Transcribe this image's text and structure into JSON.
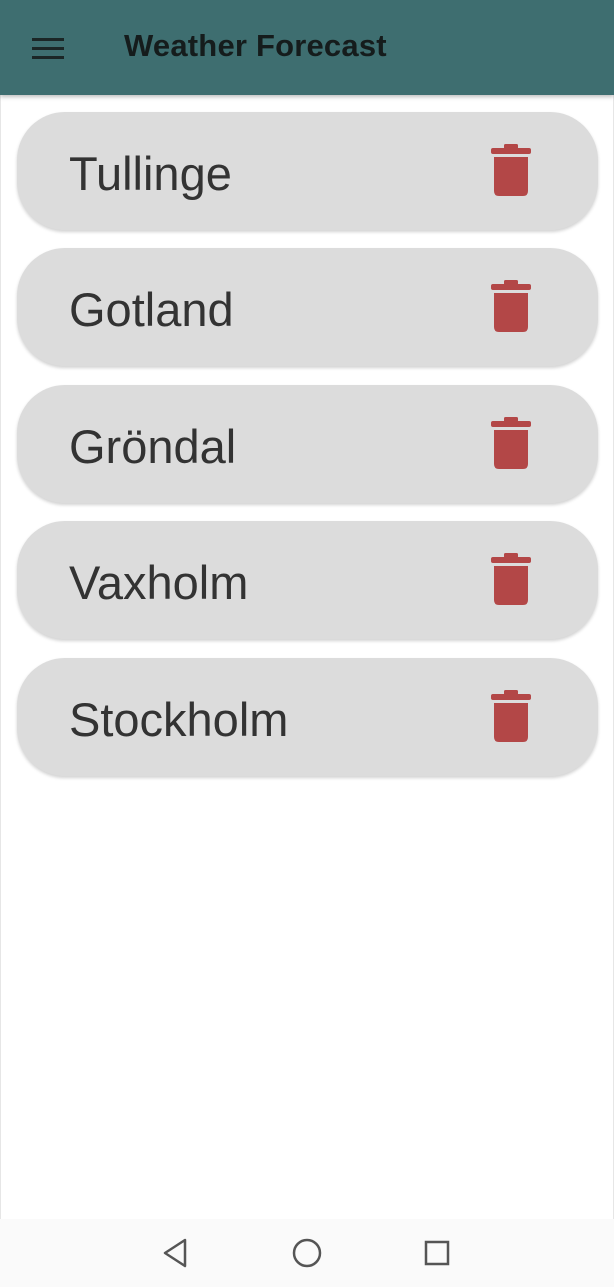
{
  "app_bar": {
    "title": "Weather Forecast",
    "menu_icon": "hamburger-menu-icon",
    "background": "#3e6e70"
  },
  "cities": [
    {
      "name": "Tullinge",
      "action_icon": "trash-icon"
    },
    {
      "name": "Gotland",
      "action_icon": "trash-icon"
    },
    {
      "name": "Gröndal",
      "action_icon": "trash-icon"
    },
    {
      "name": "Vaxholm",
      "action_icon": "trash-icon"
    },
    {
      "name": "Stockholm",
      "action_icon": "trash-icon"
    }
  ],
  "colors": {
    "card_background": "#dcdcdc",
    "delete_icon": "#b34747",
    "city_text": "#333333"
  },
  "nav_bar": {
    "icons": [
      "back-triangle-icon",
      "home-circle-icon",
      "recents-square-icon"
    ]
  }
}
